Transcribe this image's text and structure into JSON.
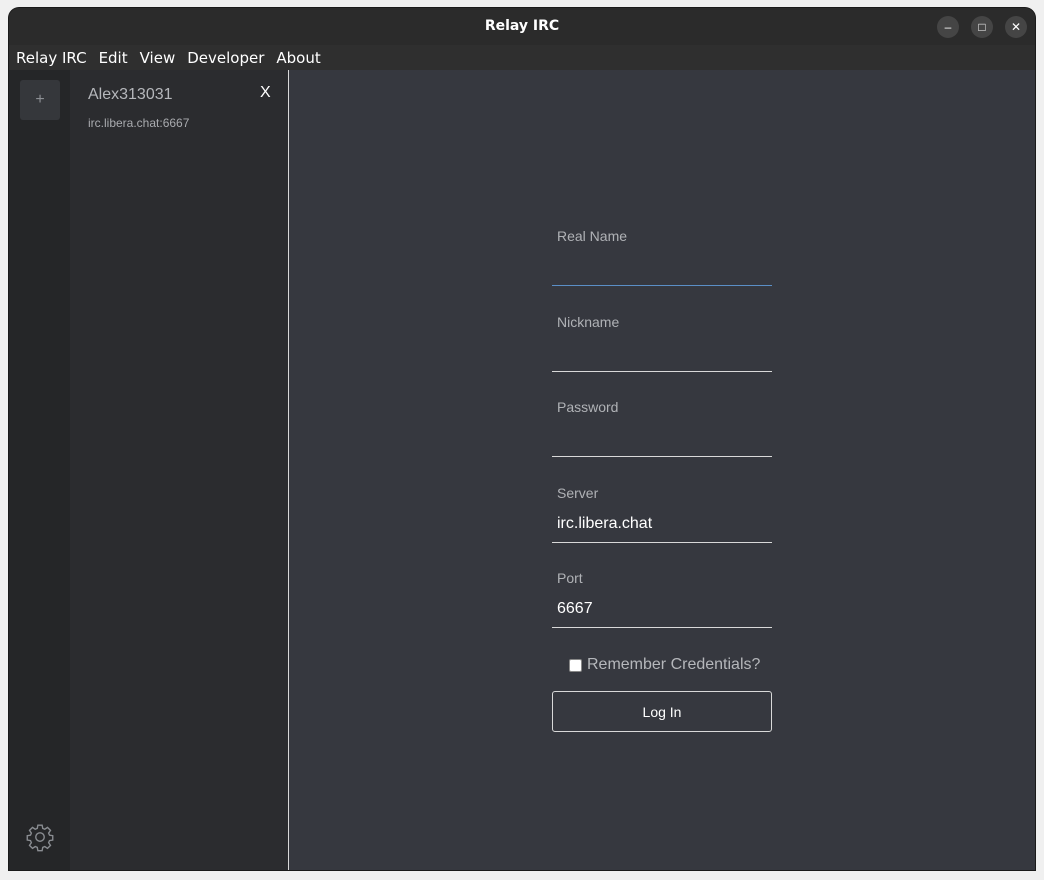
{
  "window": {
    "title": "Relay IRC",
    "controls": {
      "minimize": "–",
      "maximize": "□",
      "close": "✕"
    }
  },
  "menu": [
    "Relay IRC",
    "Edit",
    "View",
    "Developer",
    "About"
  ],
  "rail": {
    "add_label": "+",
    "settings_icon": "gear-icon"
  },
  "server_list": {
    "name": "Alex313031",
    "close_label": "X",
    "address": "irc.libera.chat:6667"
  },
  "login_form": {
    "fields": [
      {
        "label": "Real Name",
        "value": "",
        "focused": true
      },
      {
        "label": "Nickname",
        "value": ""
      },
      {
        "label": "Password",
        "value": ""
      },
      {
        "label": "Server",
        "value": "irc.libera.chat"
      },
      {
        "label": "Port",
        "value": "6667"
      }
    ],
    "remember_label": "Remember Credentials?",
    "remember_checked": false,
    "submit_label": "Log In"
  },
  "colors": {
    "accent_focus": "#5b8fc7",
    "main_bg": "#36383f",
    "sidebar_bg": "#2b2c2f"
  }
}
